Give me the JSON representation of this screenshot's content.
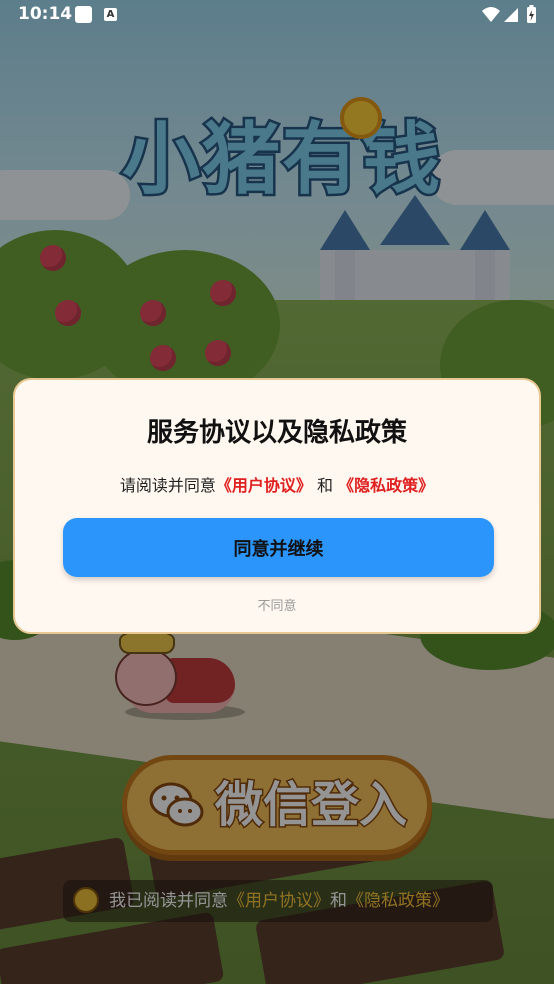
{
  "status_bar": {
    "time": "10:14",
    "notification_icon": "square-app-icon",
    "notification_icon2": "a-badge-icon",
    "notification_icon2_text": "A",
    "right_icons": [
      "wifi-icon",
      "signal-icon",
      "battery-charging-icon"
    ]
  },
  "game": {
    "logo_text": "小猪有钱",
    "wechat_login_label": "微信登入",
    "agree_prefix": "我已阅读并同意",
    "agree_link_user": "《用户协议》",
    "agree_and": "和",
    "agree_link_privacy": "《隐私政策》"
  },
  "dialog": {
    "title": "服务协议以及隐私政策",
    "msg_prefix": "请阅读并同意",
    "link_user": "《用户协议》",
    "msg_and": " 和 ",
    "link_privacy": "《隐私政策》",
    "accept_label": "同意并继续",
    "decline_label": "不同意"
  },
  "colors": {
    "accept_button": "#2b95fb",
    "link": "#e02020",
    "dialog_bg": "#fff8f0"
  }
}
